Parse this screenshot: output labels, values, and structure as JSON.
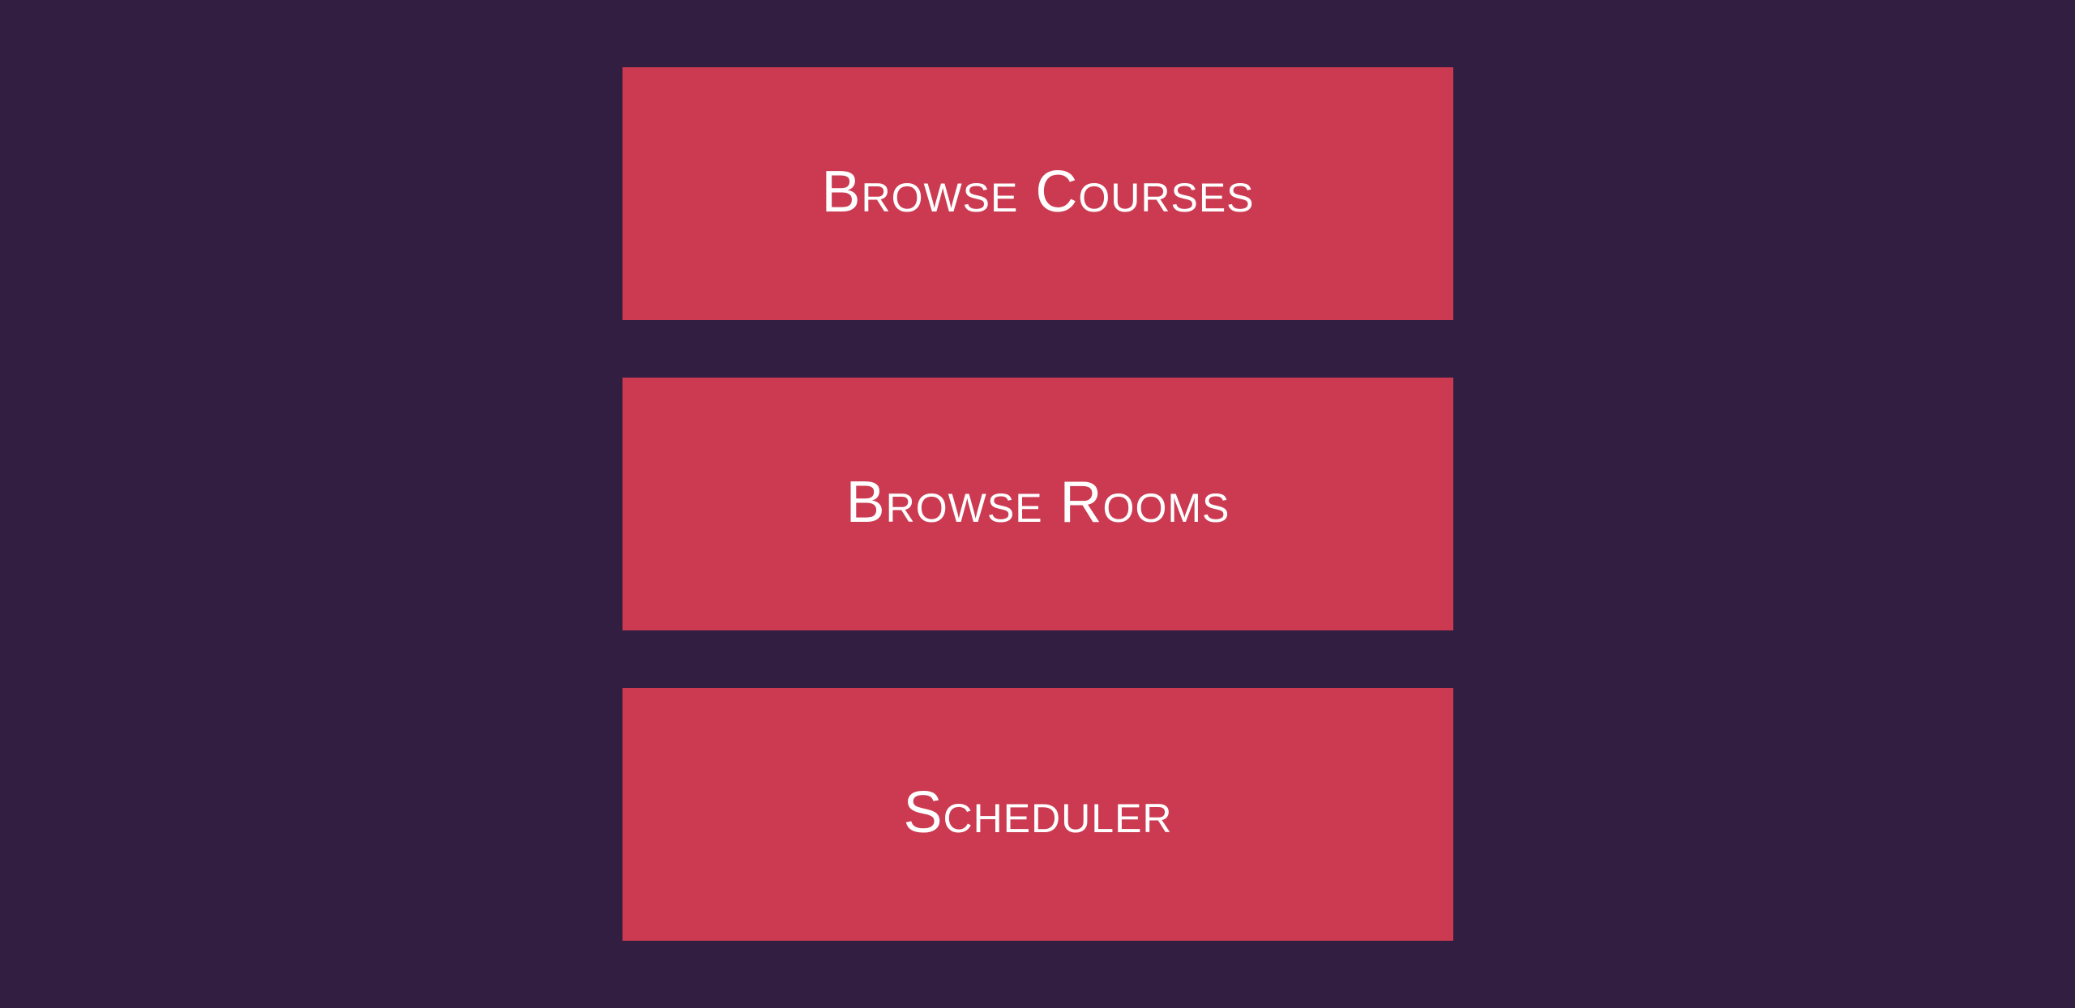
{
  "colors": {
    "background": "#311e41",
    "button": "#cb3a50",
    "text": "#ffffff"
  },
  "menu": {
    "buttons": [
      {
        "label": "Browse Courses"
      },
      {
        "label": "Browse Rooms"
      },
      {
        "label": "Scheduler"
      }
    ]
  }
}
